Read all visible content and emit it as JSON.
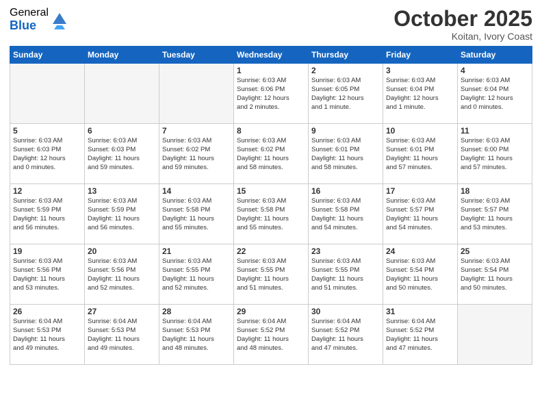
{
  "header": {
    "logo_general": "General",
    "logo_blue": "Blue",
    "month": "October 2025",
    "location": "Koitan, Ivory Coast"
  },
  "weekdays": [
    "Sunday",
    "Monday",
    "Tuesday",
    "Wednesday",
    "Thursday",
    "Friday",
    "Saturday"
  ],
  "weeks": [
    [
      {
        "day": "",
        "info": ""
      },
      {
        "day": "",
        "info": ""
      },
      {
        "day": "",
        "info": ""
      },
      {
        "day": "1",
        "info": "Sunrise: 6:03 AM\nSunset: 6:06 PM\nDaylight: 12 hours\nand 2 minutes."
      },
      {
        "day": "2",
        "info": "Sunrise: 6:03 AM\nSunset: 6:05 PM\nDaylight: 12 hours\nand 1 minute."
      },
      {
        "day": "3",
        "info": "Sunrise: 6:03 AM\nSunset: 6:04 PM\nDaylight: 12 hours\nand 1 minute."
      },
      {
        "day": "4",
        "info": "Sunrise: 6:03 AM\nSunset: 6:04 PM\nDaylight: 12 hours\nand 0 minutes."
      }
    ],
    [
      {
        "day": "5",
        "info": "Sunrise: 6:03 AM\nSunset: 6:03 PM\nDaylight: 12 hours\nand 0 minutes."
      },
      {
        "day": "6",
        "info": "Sunrise: 6:03 AM\nSunset: 6:03 PM\nDaylight: 11 hours\nand 59 minutes."
      },
      {
        "day": "7",
        "info": "Sunrise: 6:03 AM\nSunset: 6:02 PM\nDaylight: 11 hours\nand 59 minutes."
      },
      {
        "day": "8",
        "info": "Sunrise: 6:03 AM\nSunset: 6:02 PM\nDaylight: 11 hours\nand 58 minutes."
      },
      {
        "day": "9",
        "info": "Sunrise: 6:03 AM\nSunset: 6:01 PM\nDaylight: 11 hours\nand 58 minutes."
      },
      {
        "day": "10",
        "info": "Sunrise: 6:03 AM\nSunset: 6:01 PM\nDaylight: 11 hours\nand 57 minutes."
      },
      {
        "day": "11",
        "info": "Sunrise: 6:03 AM\nSunset: 6:00 PM\nDaylight: 11 hours\nand 57 minutes."
      }
    ],
    [
      {
        "day": "12",
        "info": "Sunrise: 6:03 AM\nSunset: 5:59 PM\nDaylight: 11 hours\nand 56 minutes."
      },
      {
        "day": "13",
        "info": "Sunrise: 6:03 AM\nSunset: 5:59 PM\nDaylight: 11 hours\nand 56 minutes."
      },
      {
        "day": "14",
        "info": "Sunrise: 6:03 AM\nSunset: 5:58 PM\nDaylight: 11 hours\nand 55 minutes."
      },
      {
        "day": "15",
        "info": "Sunrise: 6:03 AM\nSunset: 5:58 PM\nDaylight: 11 hours\nand 55 minutes."
      },
      {
        "day": "16",
        "info": "Sunrise: 6:03 AM\nSunset: 5:58 PM\nDaylight: 11 hours\nand 54 minutes."
      },
      {
        "day": "17",
        "info": "Sunrise: 6:03 AM\nSunset: 5:57 PM\nDaylight: 11 hours\nand 54 minutes."
      },
      {
        "day": "18",
        "info": "Sunrise: 6:03 AM\nSunset: 5:57 PM\nDaylight: 11 hours\nand 53 minutes."
      }
    ],
    [
      {
        "day": "19",
        "info": "Sunrise: 6:03 AM\nSunset: 5:56 PM\nDaylight: 11 hours\nand 53 minutes."
      },
      {
        "day": "20",
        "info": "Sunrise: 6:03 AM\nSunset: 5:56 PM\nDaylight: 11 hours\nand 52 minutes."
      },
      {
        "day": "21",
        "info": "Sunrise: 6:03 AM\nSunset: 5:55 PM\nDaylight: 11 hours\nand 52 minutes."
      },
      {
        "day": "22",
        "info": "Sunrise: 6:03 AM\nSunset: 5:55 PM\nDaylight: 11 hours\nand 51 minutes."
      },
      {
        "day": "23",
        "info": "Sunrise: 6:03 AM\nSunset: 5:55 PM\nDaylight: 11 hours\nand 51 minutes."
      },
      {
        "day": "24",
        "info": "Sunrise: 6:03 AM\nSunset: 5:54 PM\nDaylight: 11 hours\nand 50 minutes."
      },
      {
        "day": "25",
        "info": "Sunrise: 6:03 AM\nSunset: 5:54 PM\nDaylight: 11 hours\nand 50 minutes."
      }
    ],
    [
      {
        "day": "26",
        "info": "Sunrise: 6:04 AM\nSunset: 5:53 PM\nDaylight: 11 hours\nand 49 minutes."
      },
      {
        "day": "27",
        "info": "Sunrise: 6:04 AM\nSunset: 5:53 PM\nDaylight: 11 hours\nand 49 minutes."
      },
      {
        "day": "28",
        "info": "Sunrise: 6:04 AM\nSunset: 5:53 PM\nDaylight: 11 hours\nand 48 minutes."
      },
      {
        "day": "29",
        "info": "Sunrise: 6:04 AM\nSunset: 5:52 PM\nDaylight: 11 hours\nand 48 minutes."
      },
      {
        "day": "30",
        "info": "Sunrise: 6:04 AM\nSunset: 5:52 PM\nDaylight: 11 hours\nand 47 minutes."
      },
      {
        "day": "31",
        "info": "Sunrise: 6:04 AM\nSunset: 5:52 PM\nDaylight: 11 hours\nand 47 minutes."
      },
      {
        "day": "",
        "info": ""
      }
    ]
  ]
}
